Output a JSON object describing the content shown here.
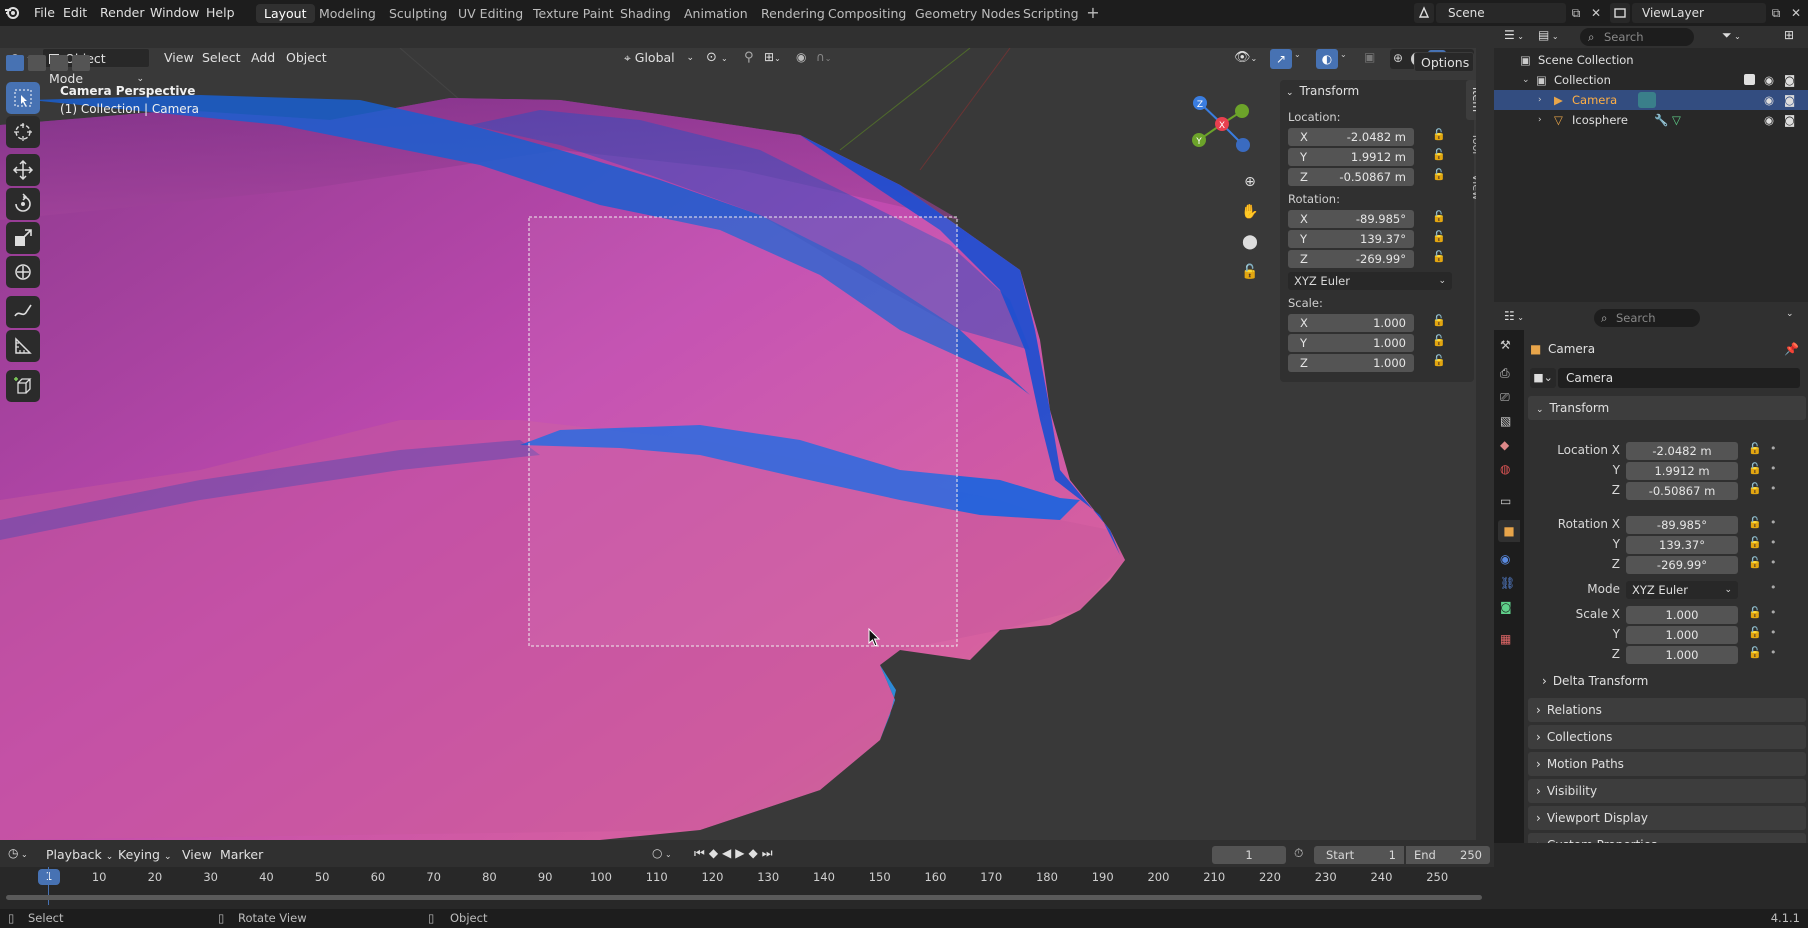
{
  "menu": [
    "File",
    "Edit",
    "Render",
    "Window",
    "Help"
  ],
  "workspaces": [
    {
      "label": "Layout",
      "active": true
    },
    {
      "label": "Modeling"
    },
    {
      "label": "Sculpting"
    },
    {
      "label": "UV Editing"
    },
    {
      "label": "Texture Paint"
    },
    {
      "label": "Shading"
    },
    {
      "label": "Animation"
    },
    {
      "label": "Rendering"
    },
    {
      "label": "Compositing"
    },
    {
      "label": "Geometry Nodes"
    },
    {
      "label": "Scripting"
    }
  ],
  "scene": "Scene",
  "view_layer": "ViewLayer",
  "header": {
    "mode": "Object Mode",
    "view": "View",
    "select": "Select",
    "add": "Add",
    "object": "Object",
    "orientation": "Global",
    "options": "Options"
  },
  "viewport": {
    "title": "Camera Perspective",
    "subtitle": "(1) Collection | Camera"
  },
  "npanel": {
    "section": "Transform",
    "location_label": "Location:",
    "location": [
      {
        "axis": "X",
        "value": "-2.0482 m"
      },
      {
        "axis": "Y",
        "value": "1.9912 m"
      },
      {
        "axis": "Z",
        "value": "-0.50867 m"
      }
    ],
    "rotation_label": "Rotation:",
    "rotation": [
      {
        "axis": "X",
        "value": "-89.985°"
      },
      {
        "axis": "Y",
        "value": "139.37°"
      },
      {
        "axis": "Z",
        "value": "-269.99°"
      }
    ],
    "rotation_mode": "XYZ Euler",
    "scale_label": "Scale:",
    "scale": [
      {
        "axis": "X",
        "value": "1.000"
      },
      {
        "axis": "Y",
        "value": "1.000"
      },
      {
        "axis": "Z",
        "value": "1.000"
      }
    ],
    "tabs": [
      "Item",
      "Tool",
      "View"
    ]
  },
  "gizmo": {
    "x": "X",
    "y": "Y",
    "z": "Z"
  },
  "outliner": {
    "search_placeholder": "Search",
    "root": "Scene Collection",
    "collection": "Collection",
    "items": [
      {
        "label": "Camera",
        "selected": true
      },
      {
        "label": "Icosphere",
        "selected": false
      }
    ]
  },
  "properties": {
    "search_placeholder": "Search",
    "object_name": "Camera",
    "datablock": "Camera",
    "transform_title": "Transform",
    "location": [
      {
        "label": "Location X",
        "value": "-2.0482 m"
      },
      {
        "label": "Y",
        "value": "1.9912 m"
      },
      {
        "label": "Z",
        "value": "-0.50867 m"
      }
    ],
    "rotation": [
      {
        "label": "Rotation X",
        "value": "-89.985°"
      },
      {
        "label": "Y",
        "value": "139.37°"
      },
      {
        "label": "Z",
        "value": "-269.99°"
      }
    ],
    "mode_label": "Mode",
    "mode_value": "XYZ Euler",
    "scale": [
      {
        "label": "Scale X",
        "value": "1.000"
      },
      {
        "label": "Y",
        "value": "1.000"
      },
      {
        "label": "Z",
        "value": "1.000"
      }
    ],
    "delta": "Delta Transform",
    "sections": [
      "Relations",
      "Collections",
      "Motion Paths",
      "Visibility",
      "Viewport Display",
      "Custom Properties"
    ]
  },
  "timeline": {
    "playback": "Playback",
    "keying": "Keying",
    "view": "View",
    "marker": "Marker",
    "current_frame": "1",
    "start_label": "Start",
    "start": "1",
    "end_label": "End",
    "end": "250",
    "ticks": [
      "1",
      "10",
      "20",
      "30",
      "40",
      "50",
      "60",
      "70",
      "80",
      "90",
      "100",
      "110",
      "120",
      "130",
      "140",
      "150",
      "160",
      "170",
      "180",
      "190",
      "200",
      "210",
      "220",
      "230",
      "240",
      "250"
    ]
  },
  "status": {
    "select": "Select",
    "rotate": "Rotate View",
    "object": "Object",
    "version": "4.1.1"
  },
  "colors": {
    "accent": "#4772b3",
    "selected_row": "#334d80",
    "x_axis": "#e8404f",
    "y_axis": "#6ca32a",
    "z_axis": "#3a7de0",
    "camera_orange": "#e8a54a"
  }
}
